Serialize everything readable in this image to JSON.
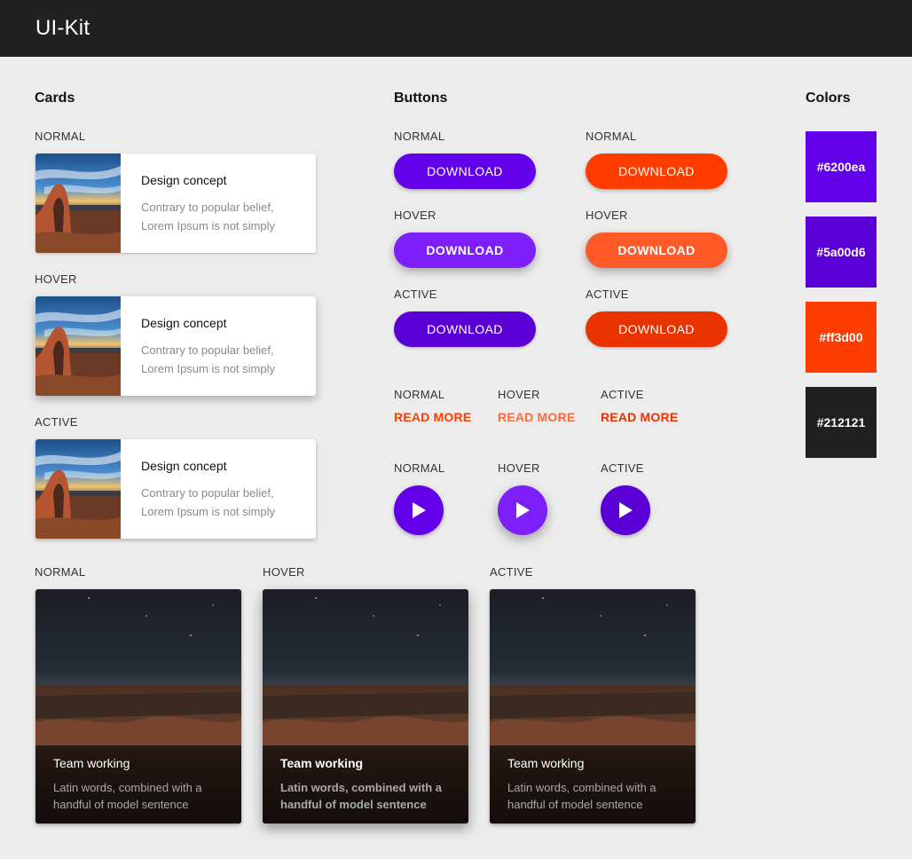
{
  "app": {
    "title": "UI-Kit"
  },
  "sections": {
    "cards": "Cards",
    "buttons": "Buttons",
    "colors": "Colors"
  },
  "states": {
    "normal": "NORMAL",
    "hover": "HOVER",
    "active": "ACTIVE"
  },
  "horizontal_card": {
    "title": "Design concept",
    "line1": "Contrary to popular belief,",
    "line2": "Lorem Ipsum is not simply"
  },
  "buttons": {
    "download_label": "DOWNLOAD",
    "read_more_label": "READ MORE",
    "play_icon": "play-icon"
  },
  "colors": [
    {
      "hex": "#6200ea"
    },
    {
      "hex": "#5a00d6"
    },
    {
      "hex": "#ff3d00"
    },
    {
      "hex": "#212121"
    }
  ],
  "state_colors": {
    "purple_normal": "#6200ea",
    "purple_hover": "#7c1ffb",
    "purple_active": "#5a00d6",
    "orange_normal": "#ff3d00",
    "orange_hover": "#ff5a28",
    "orange_active": "#e93200"
  },
  "image_card": {
    "title": "Team working",
    "line1": "Latin words, combined with a",
    "line2": "handful of model sentence"
  }
}
